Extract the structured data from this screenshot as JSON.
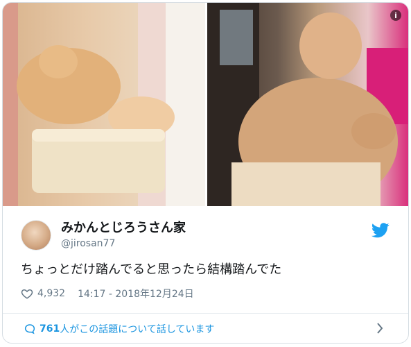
{
  "tweet": {
    "display_name": "みかんとじろうさん家",
    "handle": "@jirosan77",
    "text": "ちょっとだけ踏んでると思ったら結構踏んでた",
    "likes": "4,932",
    "timestamp": "14:17 - 2018年12月24日",
    "conversation_count": "761",
    "conversation_text": "人がこの話題について話しています"
  },
  "icons": {
    "info": "info-icon",
    "twitter": "twitter-bird-icon",
    "heart": "heart-icon",
    "reply": "speech-bubble-icon",
    "chevron": "chevron-right-icon"
  },
  "colors": {
    "twitter_blue": "#1da1f2",
    "link_blue": "#1b95e0",
    "text": "#14171a",
    "secondary": "#657786"
  }
}
